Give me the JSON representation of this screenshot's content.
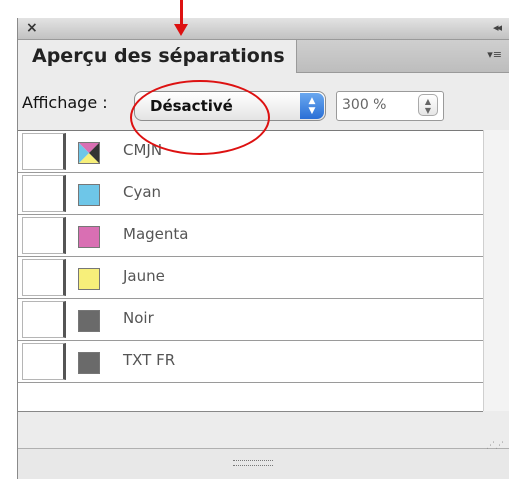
{
  "panel": {
    "close_glyph": "×",
    "collapse_glyph": "◂◂",
    "tab_title": "Aperçu des séparations",
    "menu_glyph": "▾≡"
  },
  "options": {
    "display_label": "Affichage :",
    "display_value": "Désactivé",
    "zoom_value": "300 %"
  },
  "separations": [
    {
      "name": "CMJN",
      "color": "cmyk"
    },
    {
      "name": "Cyan",
      "color": "#6ec6e8"
    },
    {
      "name": "Magenta",
      "color": "#d96fb3"
    },
    {
      "name": "Jaune",
      "color": "#f7ef7a"
    },
    {
      "name": "Noir",
      "color": "#6a6a6a"
    },
    {
      "name": "TXT FR",
      "color": "#6a6a6a"
    }
  ],
  "annotation_color": "#d11111"
}
